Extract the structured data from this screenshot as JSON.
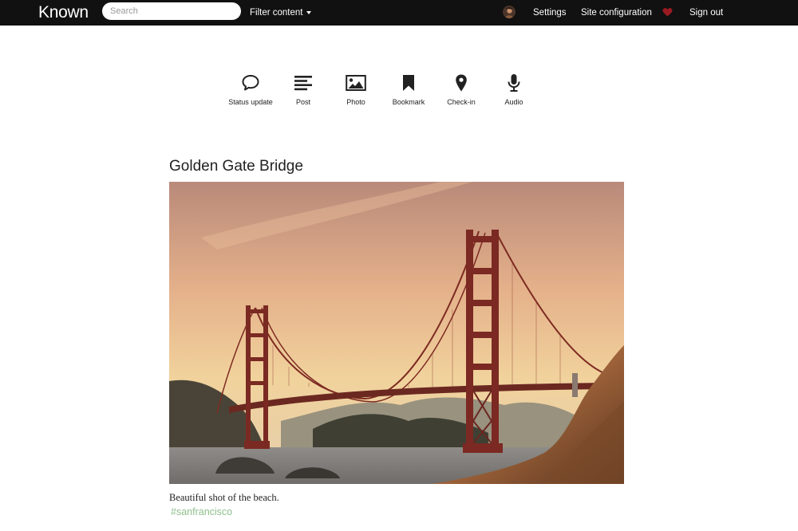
{
  "nav": {
    "brand": "Known",
    "search_placeholder": "Search",
    "filter_label": "Filter content",
    "settings_label": "Settings",
    "site_config_label": "Site configuration",
    "signout_label": "Sign out",
    "heart_icon": "heart-icon",
    "heart_color": "#9b1b22"
  },
  "content_types": [
    {
      "label": "Status update",
      "icon": "speech-bubble-icon"
    },
    {
      "label": "Post",
      "icon": "align-left-icon"
    },
    {
      "label": "Photo",
      "icon": "picture-icon"
    },
    {
      "label": "Bookmark",
      "icon": "bookmark-icon"
    },
    {
      "label": "Check-in",
      "icon": "map-pin-icon"
    },
    {
      "label": "Audio",
      "icon": "microphone-icon"
    }
  ],
  "post": {
    "title": "Golden Gate Bridge",
    "caption": "Beautiful shot of the beach.",
    "tag": "#sanfrancisco",
    "tag_color": "#8fbf8b"
  }
}
